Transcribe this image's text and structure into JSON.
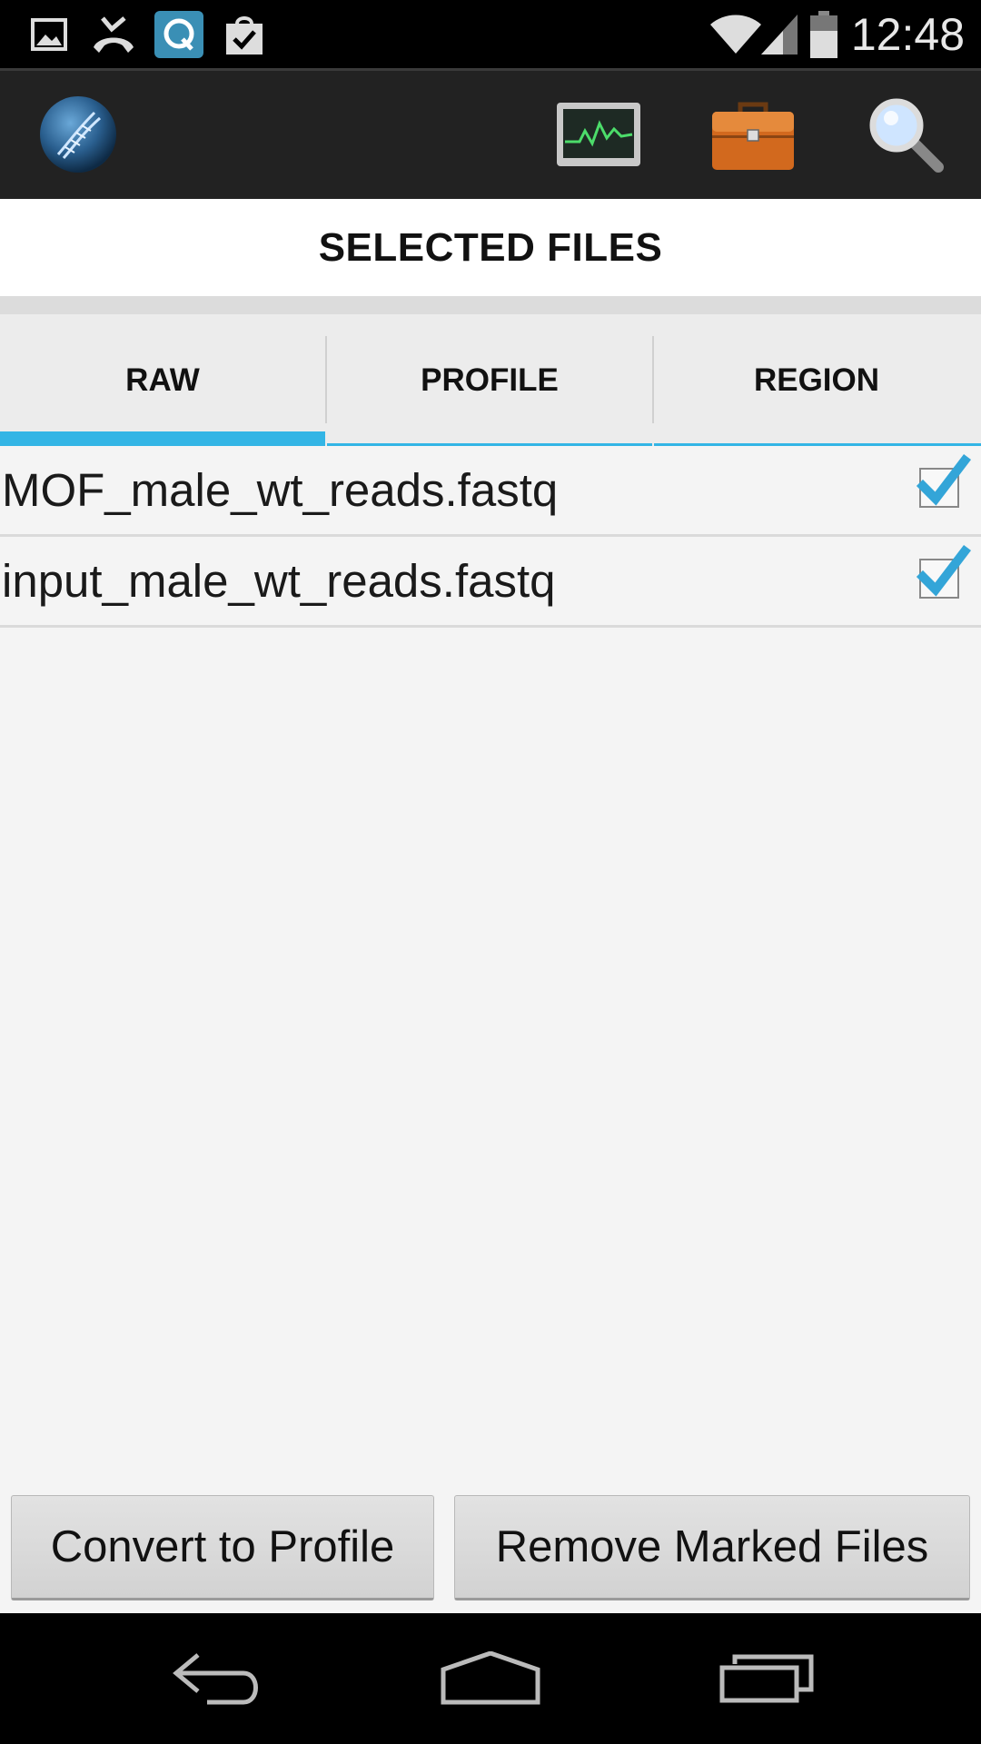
{
  "status_bar": {
    "time": "12:48",
    "left_icons": [
      "gallery-icon",
      "missed-call-icon",
      "q-app-icon",
      "shopping-bag-icon"
    ],
    "right_icons": [
      "wifi-icon",
      "cell-signal-icon",
      "battery-icon"
    ]
  },
  "action_bar": {
    "app_icon": "dna-globe-icon",
    "actions": [
      "monitor-chart-icon",
      "briefcase-icon",
      "search-icon"
    ]
  },
  "page": {
    "title": "SELECTED FILES"
  },
  "tabs": [
    {
      "label": "RAW",
      "active": true
    },
    {
      "label": "PROFILE",
      "active": false
    },
    {
      "label": "REGION",
      "active": false
    }
  ],
  "files": [
    {
      "name": "MOF_male_wt_reads.fastq",
      "checked": true
    },
    {
      "name": "input_male_wt_reads.fastq",
      "checked": true
    }
  ],
  "buttons": {
    "convert": "Convert to Profile",
    "remove": "Remove Marked Files"
  },
  "nav_bar": {
    "buttons": [
      "back-icon",
      "home-icon",
      "recents-icon"
    ]
  },
  "colors": {
    "accent": "#33b5e5",
    "action_bar": "#222222",
    "background": "#f4f4f4"
  }
}
